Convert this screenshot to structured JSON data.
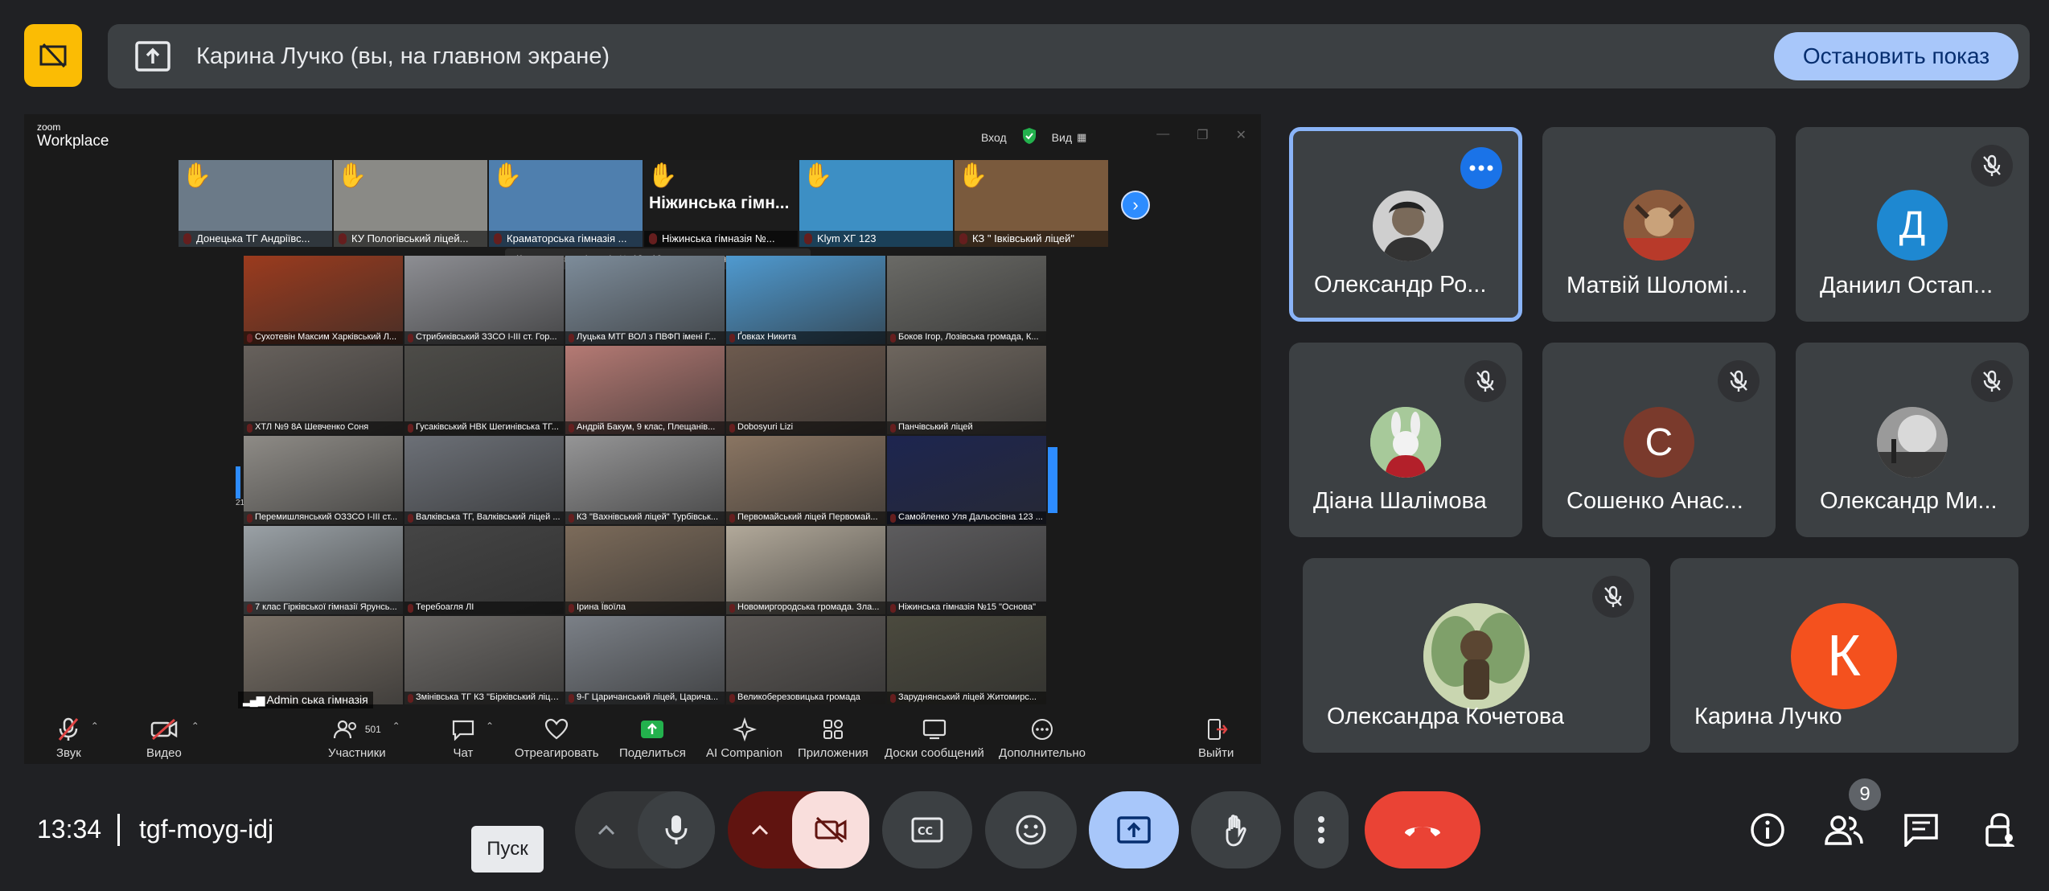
{
  "banner": {
    "presenting_text": "Карина Лучко (вы, на главном экране)",
    "stop_label": "Остановить показ"
  },
  "zoom": {
    "logo_top": "zoom",
    "logo_bottom": "Workplace",
    "sign_in": "Вход",
    "view": "Вид",
    "strip": [
      {
        "label": "Донецька ТГ Андріївс...",
        "hand": true,
        "bg": "#6b7a88"
      },
      {
        "label": "КУ Пологівський ліцей...",
        "hand": true,
        "bg": "#8a8a86"
      },
      {
        "label": "Краматорська гімназія ...",
        "hand": true,
        "bg": "#4f7fae"
      },
      {
        "label": "Ніжинська гімназія №...",
        "hand": true,
        "big": "Ніжинська гімн...",
        "bg": "#1c1c1c"
      },
      {
        "label": "Klym ХГ 123",
        "hand": true,
        "bg": "#3d8fc4"
      },
      {
        "label": "КЗ \" Івківський ліцей\"",
        "hand": true,
        "bg": "#7a5a3d"
      }
    ],
    "raise_tip": "Краматорська гімназія № 13 +10 участн. подняли руку",
    "grid": [
      {
        "label": "Сухотевін Максим Харківський Л...",
        "bg": "#9b3b1e"
      },
      {
        "label": "Стрибиківський ЗЗСО І-ІІІ ст. Гор...",
        "bg": "#8d8e93"
      },
      {
        "label": "Луцька МТГ ВОЛ з ПВФП імені Г...",
        "bg": "#7d8c9a"
      },
      {
        "label": "Ґовках Никита",
        "bg": "#4f9ad0"
      },
      {
        "label": "Боков Ігор, Лозівська громада, К...",
        "bg": "#6a6a66"
      },
      {
        "label": "ХТЛ №9 8А Шевченко Соня",
        "bg": "#67615c"
      },
      {
        "label": "Гусаківський НВК Шегинівська ТГ...",
        "bg": "#4d4c48"
      },
      {
        "label": "Андрій Бакум, 9 клас, Плещанів...",
        "bg": "#b57a74"
      },
      {
        "label": "Dobosyuri Lizi",
        "bg": "#6d5a4e"
      },
      {
        "label": "Панчівський ліцей",
        "bg": "#6e665e"
      },
      {
        "label": "Перемишлянський ОЗЗСО І-ІІІ ст...",
        "bg": "#8e8b86"
      },
      {
        "label": "Валківська ТГ, Валківський ліцей ...",
        "bg": "#6c7077"
      },
      {
        "label": "КЗ \"Вахнівський ліцей\" Турбівськ...",
        "bg": "#959596"
      },
      {
        "label": "Первомайський ліцей Первомай...",
        "bg": "#8a7562"
      },
      {
        "label": "Самойленко Уля Дальосівна 123 ...",
        "bg": "#1d2550"
      },
      {
        "label": "7 клас Гірківської гімназії Ярунсь...",
        "bg": "#9aa1a6"
      },
      {
        "label": "Теребоагля ЛІ",
        "bg": "#454545"
      },
      {
        "label": "Ірина Ївоїла",
        "bg": "#7c6b5a"
      },
      {
        "label": "Новомиргородська громада. Зла...",
        "bg": "#b2a99a"
      },
      {
        "label": "Ніжинська гімназія №15 \"Основа\"",
        "bg": "#5d5c5e"
      },
      {
        "label": "",
        "bg": "#7b7268"
      },
      {
        "label": "Змінівська ТГ КЗ \"Бірківський ліце...",
        "bg": "#6d6a67"
      },
      {
        "label": "9-Г Царичанський ліцей, Царича...",
        "bg": "#7b8087"
      },
      {
        "label": "Великоберезовицька громада",
        "bg": "#5e5a57"
      },
      {
        "label": "Заруднянський ліцей Житомирс...",
        "bg": "#4b4a3e"
      }
    ],
    "admin_label": "Admin ська гімназія",
    "side_left_number": "21",
    "toolbar": {
      "audio": "Звук",
      "video": "Видео",
      "participants": "Участники",
      "participants_count": "501",
      "chat": "Чат",
      "react": "Отреагировать",
      "share": "Поделиться",
      "ai": "AI Companion",
      "apps": "Приложения",
      "whiteboards": "Доски сообщений",
      "more": "Дополнительно",
      "leave": "Выйти"
    }
  },
  "participants": [
    {
      "name": "Олександр Ро...",
      "avatar_type": "photo",
      "avatar_color": "#cfcfcf"
    },
    {
      "name": "Матвій Шоломі...",
      "avatar_type": "photo",
      "avatar_color": "#9a4a36"
    },
    {
      "name": "Даниил Остап...",
      "avatar_type": "letter",
      "letter": "Д",
      "avatar_color": "#1e88d1",
      "muted": true
    },
    {
      "name": "Діана Шалімова",
      "avatar_type": "photo",
      "avatar_color": "#8fbf83",
      "muted": true
    },
    {
      "name": "Сошенко Анас...",
      "avatar_type": "letter",
      "letter": "С",
      "avatar_color": "#7a3a2c",
      "muted": true
    },
    {
      "name": "Олександр Ми...",
      "avatar_type": "photo",
      "avatar_color": "#7a7a7a",
      "muted": true
    },
    {
      "name": "Олександра Кочетова",
      "avatar_type": "photo",
      "avatar_color": "#a6b889",
      "muted": true
    },
    {
      "name": "Карина Лучко",
      "avatar_type": "letter",
      "letter": "К",
      "avatar_color": "#f4511e"
    }
  ],
  "bottom": {
    "time": "13:34",
    "meeting_code": "tgf-moyg-idj",
    "tooltip": "Пуск",
    "people_count": "9"
  },
  "colors": {
    "background": "#202124",
    "tile": "#3c4043",
    "accent_blue": "#a8c7fa",
    "leave_red": "#ea4335",
    "badge_yellow": "#fbbc04"
  }
}
